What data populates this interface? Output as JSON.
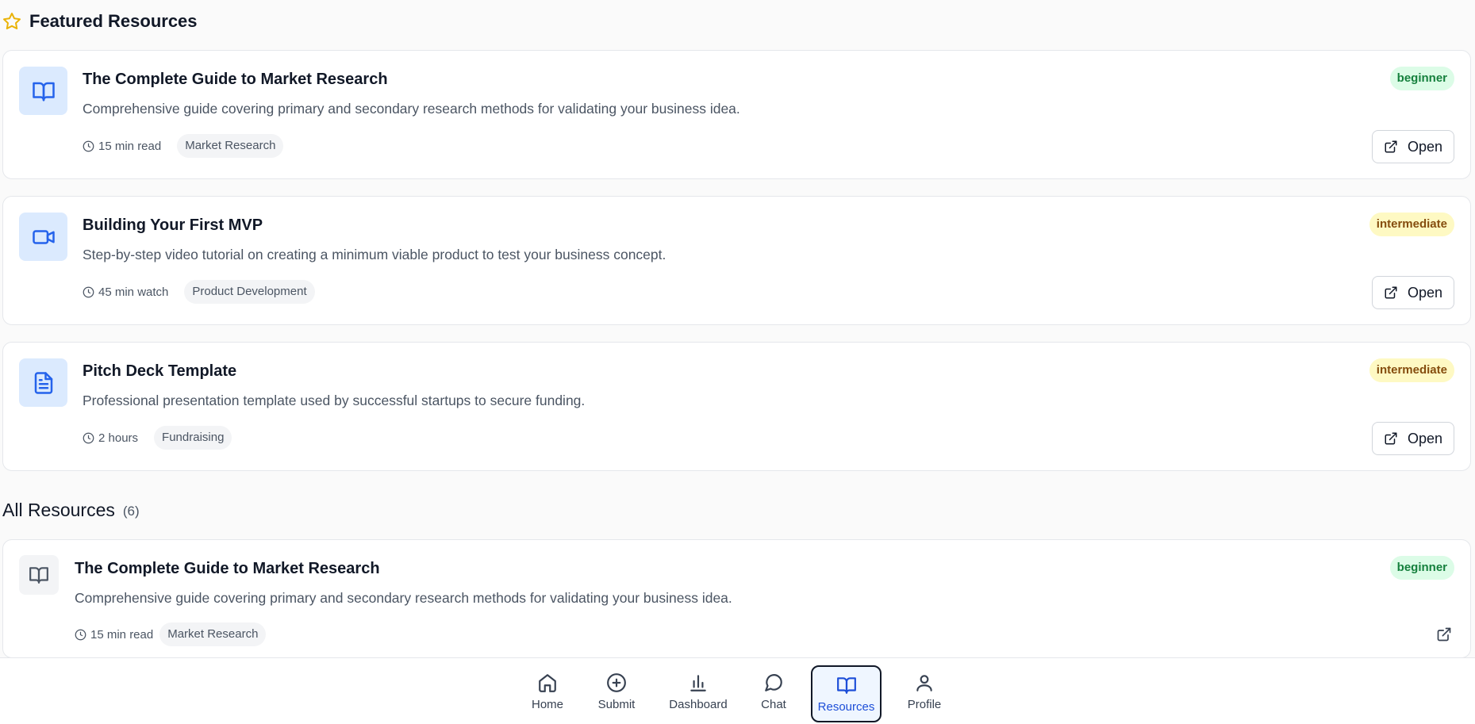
{
  "featured": {
    "title": "Featured Resources",
    "items": [
      {
        "title": "The Complete Guide to Market Research",
        "description": "Comprehensive guide covering primary and secondary research methods for validating your business idea.",
        "duration": "15 min read",
        "tag": "Market Research",
        "level": "beginner",
        "icon": "book-open-icon",
        "open_label": "Open"
      },
      {
        "title": "Building Your First MVP",
        "description": "Step-by-step video tutorial on creating a minimum viable product to test your business concept.",
        "duration": "45 min watch",
        "tag": "Product Development",
        "level": "intermediate",
        "icon": "video-icon",
        "open_label": "Open"
      },
      {
        "title": "Pitch Deck Template",
        "description": "Professional presentation template used by successful startups to secure funding.",
        "duration": "2 hours",
        "tag": "Fundraising",
        "level": "intermediate",
        "icon": "file-text-icon",
        "open_label": "Open"
      }
    ]
  },
  "all_resources": {
    "title": "All Resources",
    "count": "(6)",
    "items": [
      {
        "title": "The Complete Guide to Market Research",
        "description": "Comprehensive guide covering primary and secondary research methods for validating your business idea.",
        "duration": "15 min read",
        "tag": "Market Research",
        "level": "beginner",
        "icon": "book-open-icon"
      }
    ]
  },
  "nav": {
    "items": [
      {
        "label": "Home",
        "icon": "home-icon"
      },
      {
        "label": "Submit",
        "icon": "plus-circle-icon"
      },
      {
        "label": "Dashboard",
        "icon": "bar-chart-icon"
      },
      {
        "label": "Chat",
        "icon": "chat-bubble-icon"
      },
      {
        "label": "Resources",
        "icon": "book-open-icon",
        "active": true
      },
      {
        "label": "Profile",
        "icon": "user-icon"
      }
    ]
  },
  "colors": {
    "accent": "#2563eb",
    "beginner_bg": "#dcfce7",
    "beginner_fg": "#15803d",
    "intermediate_bg": "#fef9c3",
    "intermediate_fg": "#854d0e",
    "star": "#eab308"
  }
}
